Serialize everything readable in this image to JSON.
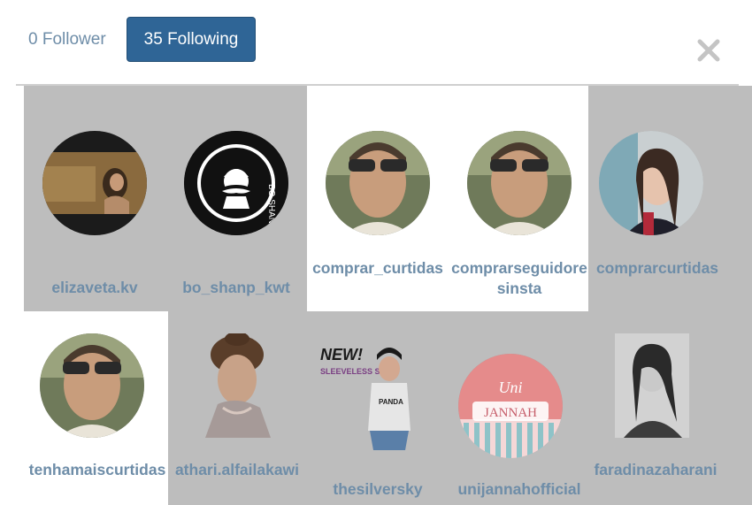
{
  "tabs": {
    "followers_label": "0 Follower",
    "following_label": "35 Following"
  },
  "close_icon": "close-icon",
  "colors": {
    "accent": "#2f6596",
    "username": "#6e8da8",
    "dim_overlay": "#bdbdbd",
    "selected_bg": "#ffffff"
  },
  "following": [
    {
      "username": "elizaveta.kv",
      "selected": false
    },
    {
      "username": "bo_shanp_kwt",
      "selected": false
    },
    {
      "username": "comprar_curtidas",
      "selected": true
    },
    {
      "username": "comprarseguidoresinsta",
      "selected": true
    },
    {
      "username": "comprarcurtidas",
      "selected": false
    },
    {
      "username": "tenhamaiscurtidas",
      "selected": true
    },
    {
      "username": "athari.alfailakawi",
      "selected": false
    },
    {
      "username": "thesilversky",
      "selected": false
    },
    {
      "username": "unijannahofficial",
      "selected": false
    },
    {
      "username": "faradinazaharani",
      "selected": false
    }
  ],
  "avatars": {
    "bo_shanp_kwt_text": "BO SHANP KWT",
    "unijannah_text_top": "Uni",
    "unijannah_text_bottom": "JANNAH",
    "thesilversky_badge": "NEW!",
    "thesilversky_sub": "SLEEVELESS SHIRT",
    "thesilversky_shirt": "PANDA"
  }
}
